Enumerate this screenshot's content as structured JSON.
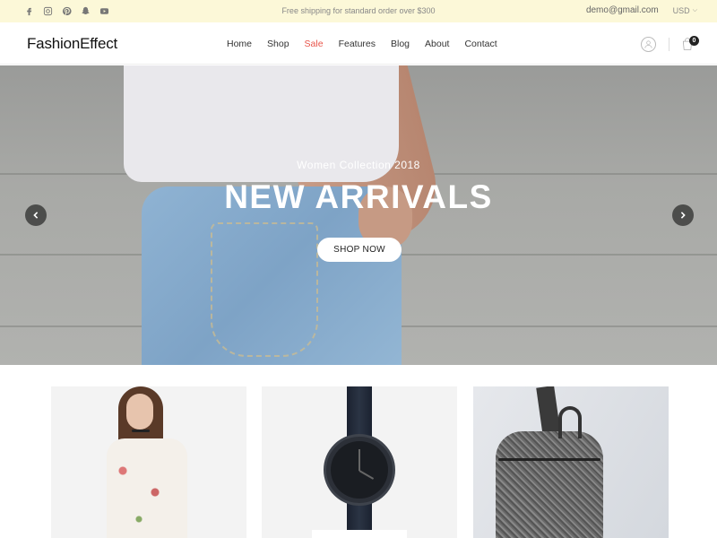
{
  "topbar": {
    "social_icons": [
      "facebook-icon",
      "instagram-icon",
      "pinterest-icon",
      "snapchat-icon",
      "youtube-icon"
    ],
    "promo": "Free shipping for standard order over $300",
    "email": "demo@gmail.com",
    "currency": "USD"
  },
  "header": {
    "logo": "FashionEffect",
    "nav": [
      "Home",
      "Shop",
      "Sale",
      "Features",
      "Blog",
      "About",
      "Contact"
    ],
    "active_accent_item": "Sale",
    "cart_count": "0"
  },
  "hero": {
    "subtitle": "Women Collection 2018",
    "title": "NEW ARRIVALS",
    "cta": "SHOP NOW"
  },
  "products": [
    {
      "image": "model-floral-dress"
    },
    {
      "image": "black-wristwatch"
    },
    {
      "image": "grey-backpack"
    }
  ],
  "colors": {
    "topbar_bg": "#fcf8d8",
    "accent": "#e8544a",
    "text": "#333333"
  }
}
